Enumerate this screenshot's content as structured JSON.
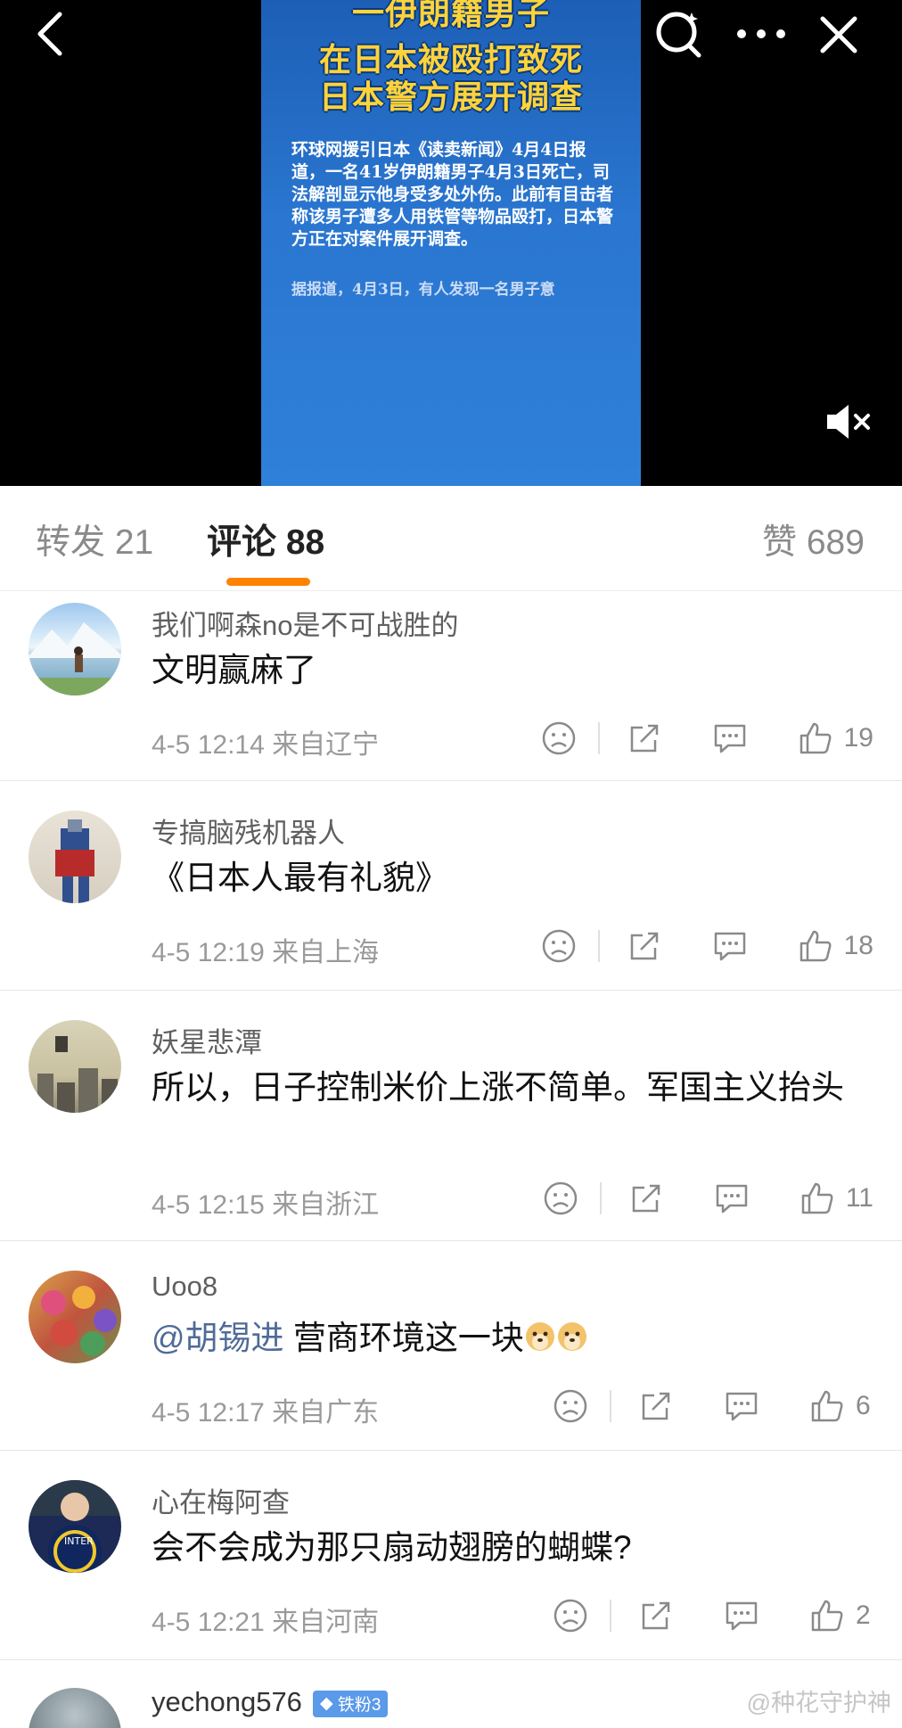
{
  "video": {
    "headline": [
      "一伊朗籍男子",
      "在日本被殴打致死",
      "日本警方展开调查"
    ],
    "body": "环球网援引日本《读卖新闻》4月4日报道，一名41岁伊朗籍男子4月3日死亡，司法解剖显示他身受多处外伤。此前有目击者称该男子遭多人用铁管等物品殴打，日本警方正在对案件展开调查。",
    "body_cut": "据报道，4月3日，有人发现一名男子意",
    "icons": [
      "back-icon",
      "search-icon",
      "more-icon",
      "close-icon",
      "mute-icon"
    ]
  },
  "tabs": {
    "repost": "转发 21",
    "comment": "评论 88",
    "like": "赞 689"
  },
  "comments": [
    {
      "name": "我们啊森no是不可战胜的",
      "text": "文明赢麻了",
      "time": "4-5 12:14",
      "location": "来自辽宁",
      "likes": "19"
    },
    {
      "name": "专搞脑残机器人",
      "text": "《日本人最有礼貌》",
      "time": "4-5 12:19",
      "location": "来自上海",
      "likes": "18"
    },
    {
      "name": "妖星悲潭",
      "text": "所以，日子控制米价上涨不简单。军国主义抬头",
      "time": "4-5 12:15",
      "location": "来自浙江",
      "likes": "11"
    },
    {
      "name": "Uoo8",
      "mention": "@胡锡进",
      "text": " 营商环境这一块",
      "time": "4-5 12:17",
      "location": "来自广东",
      "likes": "6"
    },
    {
      "name": "心在梅阿查",
      "text": "会不会成为那只扇动翅膀的蝴蝶?",
      "time": "4-5 12:21",
      "location": "来自河南",
      "likes": "2"
    },
    {
      "name": "yechong576",
      "badge": "铁粉3"
    }
  ],
  "watermark": "@种花守护神",
  "colors": {
    "accent": "#ff8200",
    "mention": "#506b98",
    "badge": "#5a9ae8"
  }
}
